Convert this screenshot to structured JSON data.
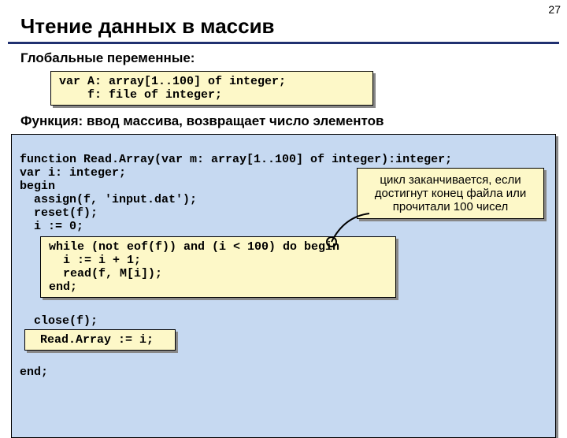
{
  "page_number": "27",
  "title": "Чтение данных в массив",
  "section_vars": "Глобальные переменные:",
  "code_vars": "var A: array[1..100] of integer;\n    f: file of integer;",
  "section_func": "Функция: ввод массива, возвращает число элементов",
  "code_main_top": "function Read.Array(var m: array[1..100] of integer):integer;\nvar i: integer;\nbegin\n  assign(f, 'input.dat');\n  reset(f);\n  i := 0;",
  "code_while": "while (not eof(f)) and (i < 100) do begin\n  i := i + 1;\n  read(f, M[i]);\nend;",
  "code_mid": "  close(f);",
  "code_return": " Read.Array := i; ",
  "code_end": "end;",
  "callout": "цикл заканчивается, если достигнут конец файла или прочитали 100 чисел"
}
